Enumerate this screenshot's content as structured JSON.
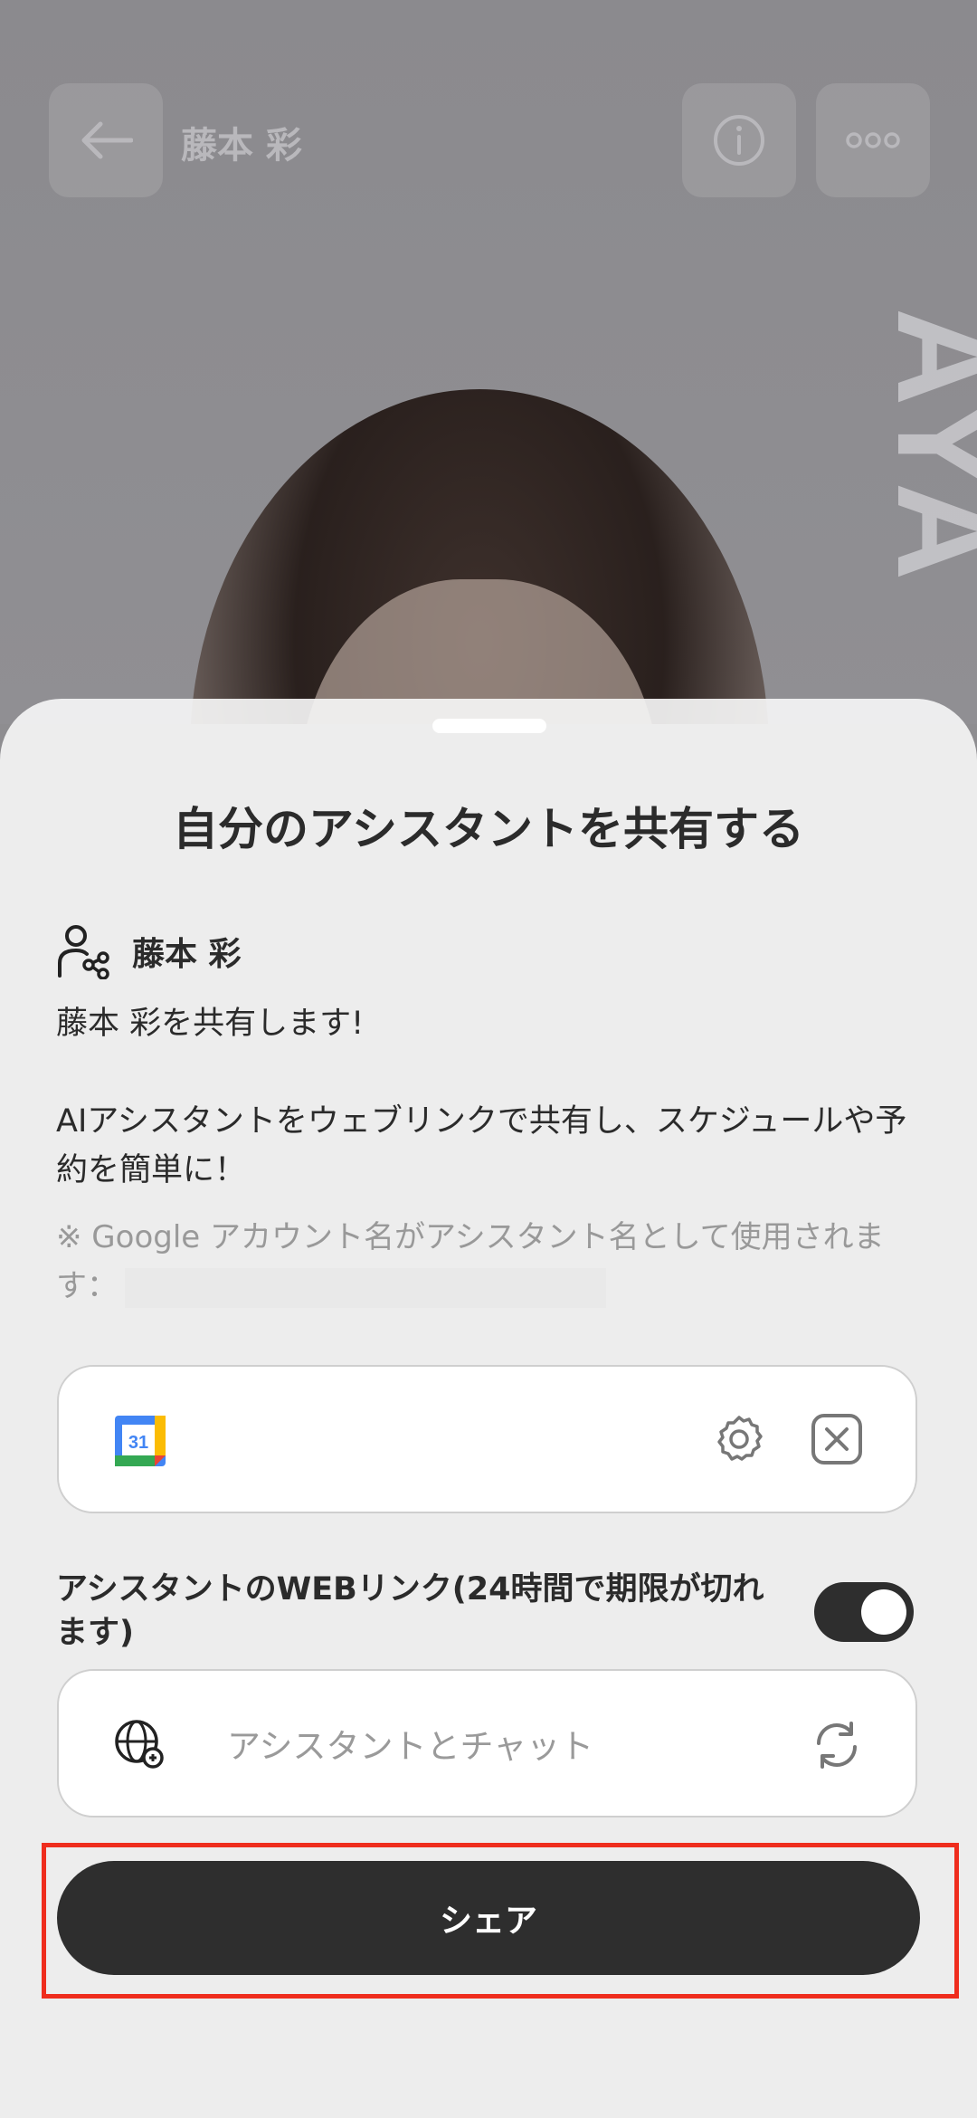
{
  "header": {
    "title": "藤本 彩",
    "brand_vertical": "AYA"
  },
  "sheet": {
    "title": "自分のアシスタントを共有する",
    "owner_name": "藤本 彩",
    "share_message": "藤本 彩を共有します!",
    "description": "AIアシスタントをウェブリンクで共有し、スケジュールや予約を簡単に！",
    "note_prefix": "※ Google アカウント名がアシスタント名として使用されます：",
    "calendar_badge": "31",
    "web_link_label": "アシスタントのWEBリンク(24時間で期限が切れます)",
    "web_link_toggle_on": true,
    "web_input_placeholder": "アシスタントとチャット",
    "share_button": "シェア"
  },
  "colors": {
    "primary_dark": "#2e2e2e",
    "highlight": "#ef2d1d",
    "muted": "#999999"
  }
}
